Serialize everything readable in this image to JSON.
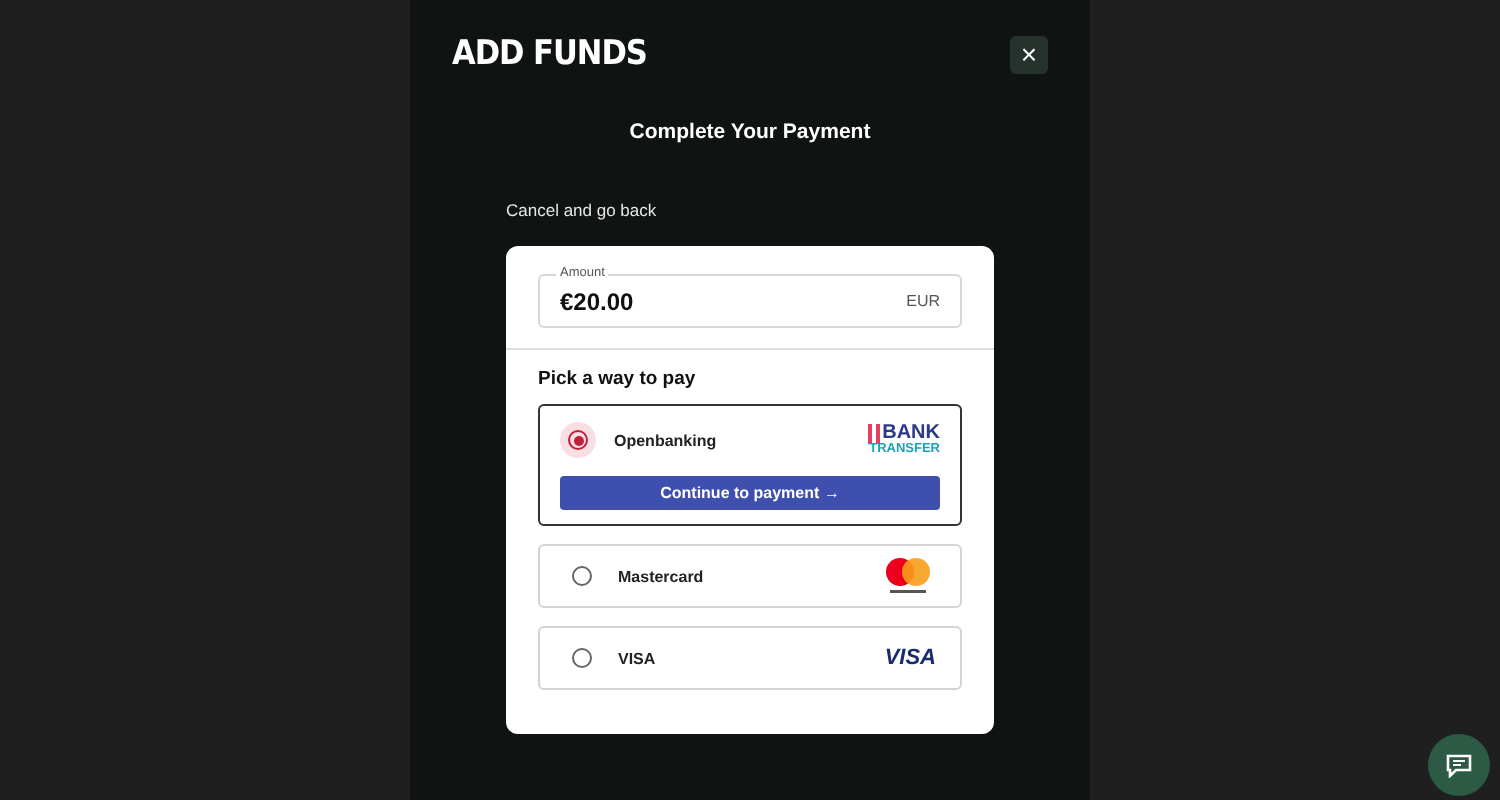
{
  "modal": {
    "title": "ADD FUNDS",
    "close": "×",
    "heading": "Complete Your Payment",
    "back_link": "Cancel and go back"
  },
  "amount": {
    "label": "Amount",
    "value": "€20.00",
    "currency": "EUR"
  },
  "methods_title": "Pick a way to pay",
  "methods": [
    {
      "name": "Openbanking",
      "kind": "bank",
      "selected": true,
      "logo_text": [
        "BANK",
        "TRANSFER"
      ],
      "action": "Continue to payment →"
    },
    {
      "name": "Mastercard",
      "kind": "mastercard",
      "selected": false
    },
    {
      "name": "VISA",
      "kind": "visa",
      "selected": false,
      "logo_text": [
        "VISA"
      ]
    }
  ]
}
